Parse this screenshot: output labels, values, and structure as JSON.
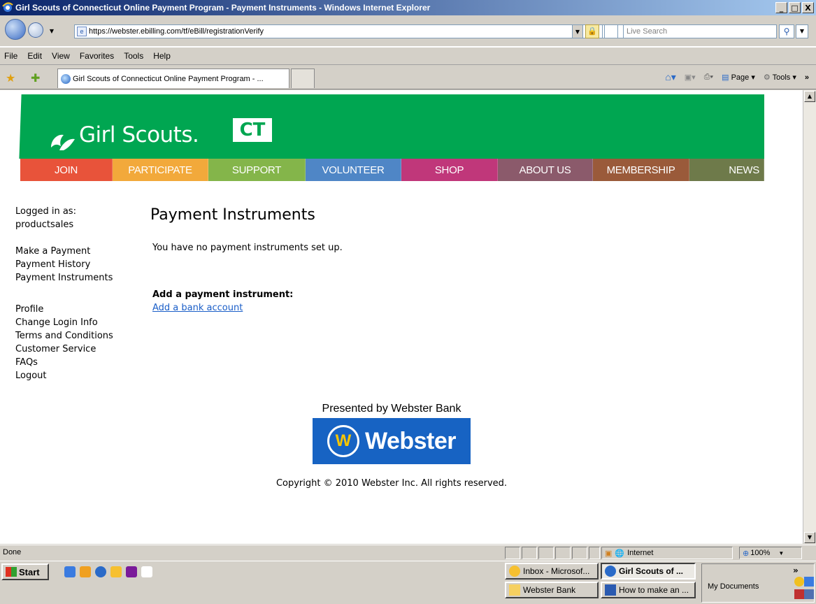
{
  "window": {
    "title": "Girl Scouts of Connecticut Online Payment Program - Payment Instruments - Windows Internet Explorer",
    "controls": [
      "_",
      "□",
      "X"
    ]
  },
  "address_bar": {
    "url": "https://webster.ebilling.com/tf/eBill/registrationVerify",
    "search_placeholder": "Live Search"
  },
  "menu": [
    "File",
    "Edit",
    "View",
    "Favorites",
    "Tools",
    "Help"
  ],
  "tab": {
    "title": "Girl Scouts of Connecticut Online Payment Program - ..."
  },
  "command_bar": {
    "page_label": "Page",
    "tools_label": "Tools"
  },
  "banner": {
    "logo_text": "Girl Scouts.",
    "logo_badge": "CT",
    "nav": [
      {
        "label": "JOIN",
        "color": "#e8533a"
      },
      {
        "label": "PARTICIPATE",
        "color": "#f2a93b"
      },
      {
        "label": "SUPPORT",
        "color": "#84b54a"
      },
      {
        "label": "VOLUNTEER",
        "color": "#4f86c6"
      },
      {
        "label": "SHOP",
        "color": "#c0377a"
      },
      {
        "label": "ABOUT US",
        "color": "#8b5a6b"
      },
      {
        "label": "MEMBERSHIP",
        "color": "#9a5a3a"
      },
      {
        "label": "NEWS",
        "color": "#6e7a4a"
      }
    ]
  },
  "sidebar": {
    "logged_in_label": "Logged in as:",
    "username": "productsales",
    "payment_links": [
      "Make a Payment",
      "Payment History",
      "Payment Instruments"
    ],
    "account_links": [
      "Profile",
      "Change Login Info",
      "Terms and Conditions",
      "Customer Service",
      "FAQs",
      "Logout"
    ]
  },
  "main": {
    "heading": "Payment Instruments",
    "message": "You have no payment instruments set up.",
    "add_heading": "Add a payment instrument:",
    "add_link": "Add a bank account"
  },
  "footer": {
    "presented_by": "Presented by Webster Bank",
    "bank_logo_text": "Webster",
    "bank_logo_mark": "W",
    "copyright": "Copyright © 2010 Webster Inc. All rights reserved."
  },
  "status_bar": {
    "status": "Done",
    "zone": "Internet",
    "zoom": "100%"
  },
  "taskbar": {
    "start_label": "Start",
    "tasks": [
      {
        "label": "Inbox - Microsof...",
        "active": false
      },
      {
        "label": "Girl Scouts of ...",
        "active": true
      },
      {
        "label": "Webster Bank",
        "active": false
      },
      {
        "label": "How to make an ...",
        "active": false
      }
    ],
    "tray_label": "My Documents"
  },
  "colors": {
    "banner_green": "#00a651",
    "webster_blue": "#1763c3",
    "link_blue": "#1a5ec8"
  }
}
